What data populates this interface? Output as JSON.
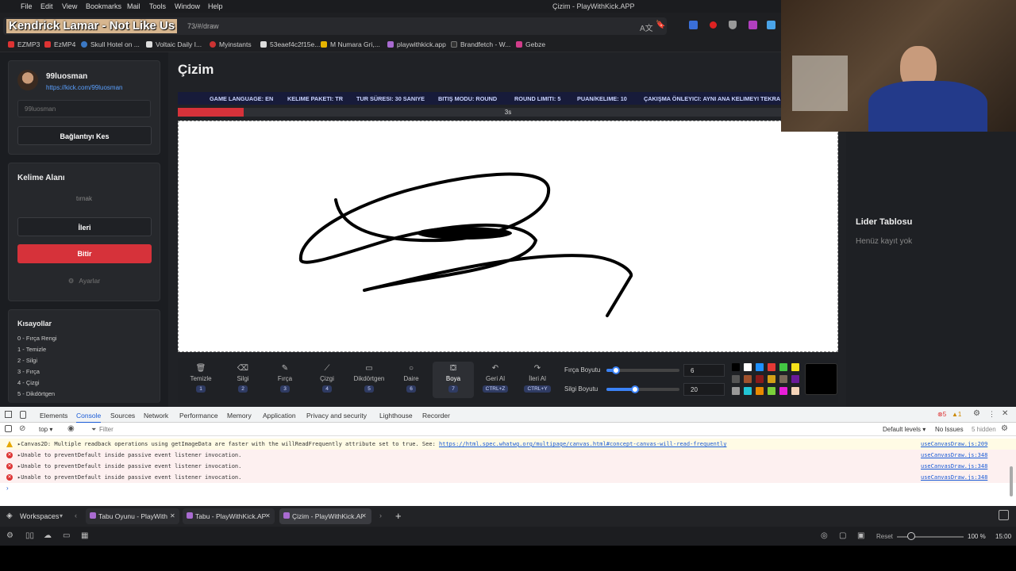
{
  "menu": {
    "items": [
      "File",
      "Edit",
      "View",
      "Bookmarks",
      "Mail",
      "Tools",
      "Window",
      "Help"
    ],
    "window_title": "Çizim - PlayWithKick.APP"
  },
  "address": {
    "url_visible": "73/#/draw",
    "now_playing": "Kendrick Lamar - Not Like Us"
  },
  "bookmarks": [
    {
      "label": "EZMP3",
      "color": "#d33"
    },
    {
      "label": "EzMP4",
      "color": "#d33"
    },
    {
      "label": "Skull Hotel on ...",
      "color": "#3b78c4"
    },
    {
      "label": "Voltaic Daily I...",
      "color": "#ddd"
    },
    {
      "label": "Myinstants",
      "color": "#c33"
    },
    {
      "label": "53eaef4c2f15e...",
      "color": "#ddd"
    },
    {
      "label": "M Numara Gri,...",
      "color": "#e6b400"
    },
    {
      "label": "playwithkick.app",
      "color": "#a96bd1"
    },
    {
      "label": "Brandfetch - W...",
      "color": "#333"
    },
    {
      "label": "Gebze",
      "color": "#d13d8a"
    }
  ],
  "profile": {
    "name": "99luosman",
    "link": "https://kick.com/99luosman",
    "input_placeholder": "99luosman",
    "disconnect": "Bağlantıyı Kes"
  },
  "word_area": {
    "title": "Kelime Alanı",
    "word": "tırnak",
    "next": "İleri",
    "finish": "Bitir",
    "settings": "Ayarlar"
  },
  "shortcuts": {
    "title": "Kısayollar",
    "items": [
      "0 - Fırça Rengi",
      "1 - Temizle",
      "2 - Silgi",
      "3 - Fırça",
      "4 - Çizgi",
      "5 - Dikdörtgen"
    ]
  },
  "main": {
    "title": "Çizim",
    "tags": [
      "GAME LANGUAGE: EN",
      "KELIME PAKETI: TR",
      "TUR SÜRESI: 30 SANIYE",
      "BITIŞ MODU: ROUND",
      "ROUND LIMITI: 5",
      "PUAN/KELIME: 10",
      "ÇAKIŞMA ÖNLEYICI: AYNI ANA KELIMEYI TEKRA"
    ],
    "timer_label": "3s",
    "timer_progress": 0.1
  },
  "tools": [
    {
      "label": "Temizle",
      "key": "1",
      "icon": "trash-icon"
    },
    {
      "label": "Silgi",
      "key": "2",
      "icon": "eraser-icon"
    },
    {
      "label": "Fırça",
      "key": "3",
      "icon": "brush-icon"
    },
    {
      "label": "Çizgi",
      "key": "4",
      "icon": "line-icon"
    },
    {
      "label": "Dikdörtgen",
      "key": "5",
      "icon": "rectangle-icon"
    },
    {
      "label": "Daire",
      "key": "6",
      "icon": "circle-icon"
    },
    {
      "label": "Boya",
      "key": "7",
      "icon": "bucket-icon"
    },
    {
      "label": "Geri Al",
      "key": "CTRL+Z",
      "icon": "undo-icon"
    },
    {
      "label": "İleri Al",
      "key": "CTRL+Y",
      "icon": "redo-icon"
    }
  ],
  "brush": {
    "brush_label": "Fırça Boyutu",
    "brush_value": "6",
    "eraser_label": "Silgi Boyutu",
    "eraser_value": "20",
    "palette": [
      "#000000",
      "#ffffff",
      "#1e90ff",
      "#e53935",
      "#43c743",
      "#f5e21b",
      "#555555",
      "#a0522d",
      "#8b1a1a",
      "#d4a017",
      "#7a6a5a",
      "#6a1b9a",
      "#999999",
      "#22c5d5",
      "#e88a00",
      "#7ad03a",
      "#e81ed8",
      "#f3d3b8"
    ],
    "current_color": "#000000"
  },
  "leaderboard": {
    "title": "Lider Tablosu",
    "empty": "Henüz kayıt yok"
  },
  "devtools": {
    "tabs": [
      "Elements",
      "Console",
      "Sources",
      "Network",
      "Performance",
      "Memory",
      "Application",
      "Privacy and security",
      "Lighthouse",
      "Recorder"
    ],
    "errors": "5",
    "warnings": "1",
    "context": "top",
    "filter_placeholder": "Filter",
    "levels": "Default levels",
    "issues": "No Issues",
    "hidden": "5 hidden",
    "logs": [
      {
        "type": "warning",
        "msg": "▸Canvas2D: Multiple readback operations using getImageData are faster with the willReadFrequently attribute set to true. See: ",
        "link": "https://html.spec.whatwg.org/multipage/canvas.html#concept-canvas-will-read-frequently",
        "src": "useCanvasDraw.js:209"
      },
      {
        "type": "error",
        "msg": "▸Unable to preventDefault inside passive event listener invocation.",
        "link": "",
        "src": "useCanvasDraw.js:348"
      },
      {
        "type": "error",
        "msg": "▸Unable to preventDefault inside passive event listener invocation.",
        "link": "",
        "src": "useCanvasDraw.js:348"
      },
      {
        "type": "error",
        "msg": "▸Unable to preventDefault inside passive event listener invocation.",
        "link": "",
        "src": "useCanvasDraw.js:348"
      }
    ]
  },
  "tabstrip": {
    "workspaces": "Workspaces",
    "tabs": [
      "Tabu Oyunu - PlayWith",
      "Tabu - PlayWithKick.AP",
      "Çizim - PlayWithKick.Al"
    ]
  },
  "statusbar": {
    "reset": "Reset",
    "zoom": "100 %",
    "time": "15:00"
  }
}
